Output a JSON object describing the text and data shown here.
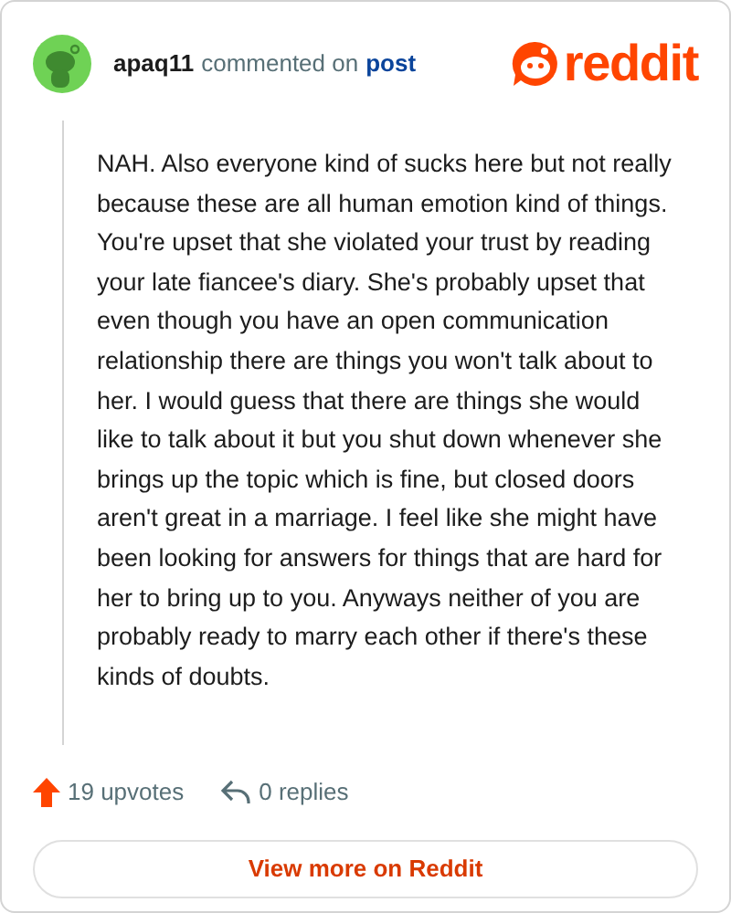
{
  "header": {
    "username": "apaq11",
    "action": "commented on",
    "link": "post",
    "brand": "reddit"
  },
  "comment": {
    "body": "NAH. Also everyone kind of sucks here but not really because these are all human emotion kind of things. You're upset that she violated your trust by reading your late fiancee's diary. She's probably upset that even though you have an open communication relationship there are things you won't talk about to her. I would guess that there are things she would like to talk about it but you shut down whenever she brings up the topic which is fine, but closed doors aren't great in a marriage. I feel like she might have been looking for answers for things that are hard for her to bring up to you. Anyways neither of you are probably ready to marry each other if there's these kinds of doubts."
  },
  "stats": {
    "upvotes": "19 upvotes",
    "replies": "0 replies"
  },
  "button": "View more on Reddit"
}
